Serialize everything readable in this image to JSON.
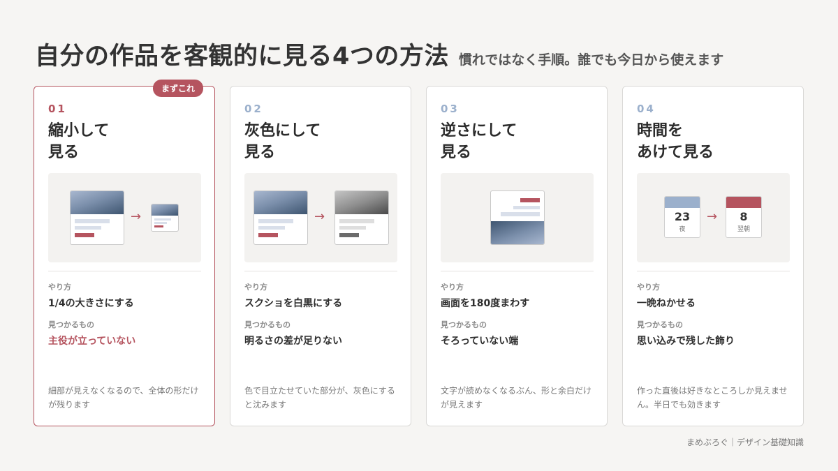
{
  "header": {
    "title": "自分の作品を客観的に見る4つの方法",
    "subtitle": "慣れではなく手順。誰でも今日から使えます"
  },
  "cards": [
    {
      "badge": "まずこれ",
      "number": "01",
      "title_line1": "縮小して",
      "title_line2": "見る",
      "method_label": "やり方",
      "method": "1/4の大きさにする",
      "find_label": "見つかるもの",
      "find": "主役が立っていない",
      "note": "細部が見えなくなるので、全体の形だけが残ります",
      "arrow": "→"
    },
    {
      "number": "02",
      "title_line1": "灰色にして",
      "title_line2": "見る",
      "method_label": "やり方",
      "method": "スクショを白黒にする",
      "find_label": "見つかるもの",
      "find": "明るさの差が足りない",
      "note": "色で目立たせていた部分が、灰色にすると沈みます",
      "arrow": "→"
    },
    {
      "number": "03",
      "title_line1": "逆さにして",
      "title_line2": "見る",
      "method_label": "やり方",
      "method": "画面を180度まわす",
      "find_label": "見つかるもの",
      "find": "そろっていない端",
      "note": "文字が読めなくなるぶん、形と余白だけが見えます"
    },
    {
      "number": "04",
      "title_line1": "時間を",
      "title_line2": "あけて見る",
      "method_label": "やり方",
      "method": "一晩ねかせる",
      "find_label": "見つかるもの",
      "find": "思い込みで残した飾り",
      "note": "作った直後は好きなところしか見えません。半日でも効きます",
      "arrow": "→",
      "calendar_before": {
        "day": "23",
        "label": "夜"
      },
      "calendar_after": {
        "day": "8",
        "label": "翌朝"
      }
    }
  ],
  "footer": "まめぶろぐ｜デザイン基礎知識",
  "colors": {
    "accent": "#b5545f",
    "number_blue": "#9bb0cc",
    "background": "#f6f5f3"
  }
}
